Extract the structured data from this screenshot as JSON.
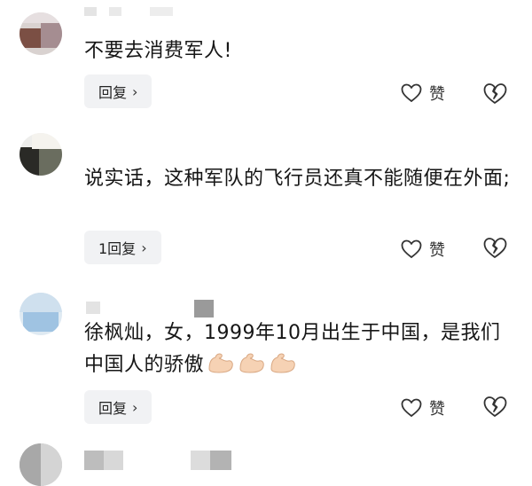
{
  "comments": [
    {
      "text": "不要去消费军人!",
      "reply_label": "回复",
      "like_label": "赞"
    },
    {
      "text": "说实话，这种军队的飞行员还真不能随便在外面;",
      "reply_label": "1回复",
      "like_label": "赞"
    },
    {
      "text": "徐枫灿，女，1999年10月出生于中国，是我们中国人的骄傲",
      "reply_label": "回复",
      "like_label": "赞",
      "emojis": [
        "flexed-biceps",
        "flexed-biceps",
        "flexed-biceps"
      ]
    }
  ],
  "colors": {
    "reply_bg": "#f1f2f4",
    "text": "#161616",
    "icon": "#333333"
  },
  "icons": {
    "like": "heart-outline-icon",
    "dislike": "broken-heart-outline-icon",
    "reply_chevron": "chevron-right-icon"
  }
}
